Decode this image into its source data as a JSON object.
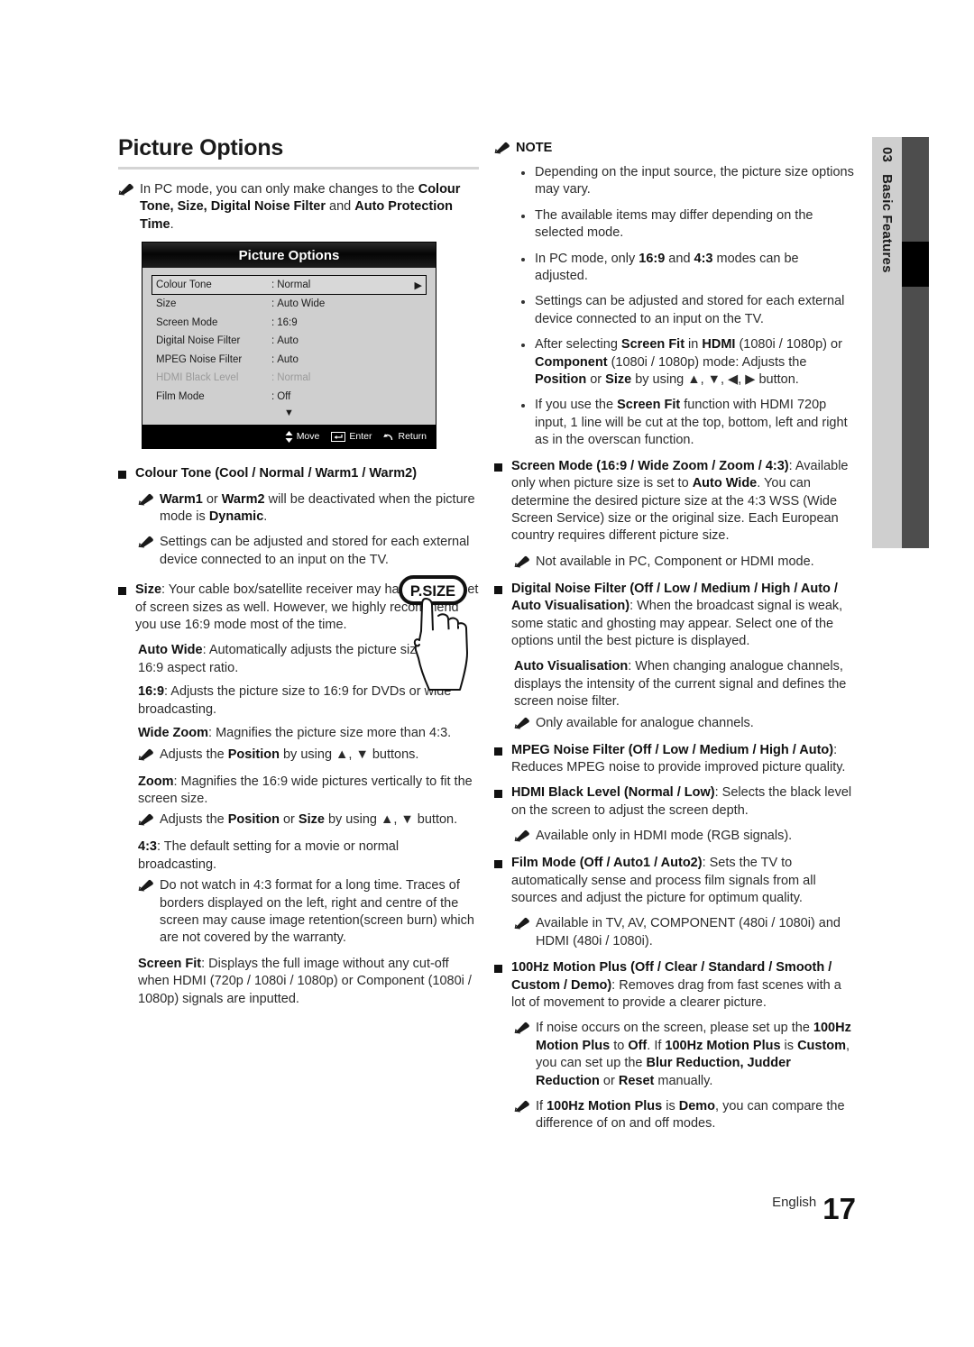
{
  "page_title": "Picture Options",
  "chapter_tab": {
    "number": "03",
    "label": "Basic Features"
  },
  "footer": {
    "language": "English",
    "page_number": "17"
  },
  "left_column": {
    "intro_note": {
      "line1": "In PC mode, you can only make changes to the ",
      "bold1": "Colour Tone, Size, Digital Noise Filter",
      "mid1": " and ",
      "bold2": "Auto Protection Time",
      "end1": "."
    },
    "osd": {
      "title": "Picture Options",
      "rows": [
        {
          "label": "Colour Tone",
          "value": "Normal",
          "selected": true,
          "dim": false,
          "arrow": "▶"
        },
        {
          "label": "Size",
          "value": "Auto Wide",
          "selected": false,
          "dim": false,
          "arrow": ""
        },
        {
          "label": "Screen Mode",
          "value": "16:9",
          "selected": false,
          "dim": false,
          "arrow": ""
        },
        {
          "label": "Digital Noise Filter",
          "value": "Auto",
          "selected": false,
          "dim": false,
          "arrow": ""
        },
        {
          "label": "MPEG Noise Filter",
          "value": "Auto",
          "selected": false,
          "dim": false,
          "arrow": ""
        },
        {
          "label": "HDMI Black Level",
          "value": "Normal",
          "selected": false,
          "dim": true,
          "arrow": ""
        },
        {
          "label": "Film Mode",
          "value": "Off",
          "selected": false,
          "dim": false,
          "arrow": ""
        }
      ],
      "scroll_down_icon": "▼",
      "footer": {
        "move": "Move",
        "enter": "Enter",
        "return": "Return"
      }
    },
    "remote_button_label": "P.SIZE",
    "items": {
      "colour_tone_heading": "Colour Tone (Cool / Normal / Warm1 / Warm2)",
      "colour_tone_note1_a": "Warm1",
      "colour_tone_note1_b": " or ",
      "colour_tone_note1_c": "Warm2",
      "colour_tone_note1_d": " will be deactivated when the picture mode is ",
      "colour_tone_note1_e": "Dynamic",
      "colour_tone_note1_f": ".",
      "colour_tone_note2": "Settings can be adjusted and stored for each external device connected to an input on the TV.",
      "size_heading_bold": "Size",
      "size_heading_rest": ": Your cable box/satellite receiver may have its own set of screen sizes as well. However, we highly recommend you use 16:9 mode most of the time.",
      "auto_wide_bold": "Auto Wide",
      "auto_wide_rest": ": Automatically adjusts the picture size to the 16:9 aspect ratio.",
      "sixteen_nine_bold": "16:9",
      "sixteen_nine_rest": ": Adjusts the picture size to 16:9 for DVDs or wide broadcasting.",
      "wide_zoom_bold": "Wide Zoom",
      "wide_zoom_rest": ": Magnifies the picture size more than 4:3.",
      "wide_zoom_note_a": "Adjusts the ",
      "wide_zoom_note_b": "Position",
      "wide_zoom_note_c": " by using ▲, ▼ buttons.",
      "zoom_bold": "Zoom",
      "zoom_rest": ": Magnifies the 16:9 wide pictures vertically to fit the screen size.",
      "zoom_note_a": "Adjusts the ",
      "zoom_note_b": "Position",
      "zoom_note_c": " or ",
      "zoom_note_d": "Size",
      "zoom_note_e": " by using ▲, ▼ button.",
      "four_three_bold": "4:3",
      "four_three_rest": ": The default setting for a movie or normal broadcasting.",
      "four_three_note": "Do not watch in 4:3 format for a long time. Traces of borders displayed on the left, right and centre of the screen may cause image retention(screen burn) which are not covered by the warranty.",
      "screen_fit_bold": "Screen Fit",
      "screen_fit_rest": ": Displays the full image without any cut-off when HDMI (720p / 1080i / 1080p) or Component (1080i / 1080p) signals are inputted."
    }
  },
  "right_column": {
    "note_heading": "NOTE",
    "notes": [
      {
        "text": "Depending on the input source, the picture size options may vary."
      },
      {
        "text": "The available items may differ depending on the selected mode."
      }
    ],
    "note3": {
      "a": "In PC mode, only ",
      "b": "16:9",
      "c": " and ",
      "d": "4:3",
      "e": " modes can be adjusted."
    },
    "note4": "Settings can be adjusted and stored for each external device connected to an input on the TV.",
    "note5": {
      "a": "After selecting ",
      "b": "Screen Fit",
      "c": " in ",
      "d": "HDMI",
      "e": " (1080i / 1080p) or ",
      "f": "Component",
      "g": " (1080i / 1080p) mode: Adjusts the ",
      "h": "Position",
      "i": " or ",
      "j": "Size",
      "k": " by using ▲, ▼, ◀, ▶ button."
    },
    "note6": {
      "a": "If you use the ",
      "b": "Screen Fit",
      "c": " function with HDMI 720p input, 1 line will be cut at the top, bottom, left and right as in the overscan function."
    },
    "screen_mode": {
      "heading": "Screen Mode (16:9 / Wide Zoom / Zoom / 4:3)",
      "body_a": ": Available only when picture size is set to ",
      "body_b": "Auto Wide",
      "body_c": ". You can determine the desired picture size at the 4:3 WSS (Wide Screen Service) size or the original size. Each European country requires different picture size.",
      "note": "Not available in PC, Component or HDMI mode."
    },
    "digital_noise_filter": {
      "heading": "Digital Noise Filter (Off / Low / Medium / High / Auto / Auto Visualisation)",
      "body": ": When the broadcast signal is weak, some static and ghosting may appear. Select one of the options until the best picture is displayed.",
      "auto_vis_bold": "Auto Visualisation",
      "auto_vis_rest": ": When changing analogue channels, displays the intensity of the current signal and defines the screen noise filter.",
      "note": "Only available for analogue channels."
    },
    "mpeg_noise_filter": {
      "heading": "MPEG Noise Filter (Off / Low / Medium / High / Auto)",
      "body": ": Reduces MPEG noise to provide improved picture quality."
    },
    "hdmi_black_level": {
      "heading": "HDMI Black Level (Normal / Low)",
      "body": ": Selects the black level on the screen to adjust the screen depth.",
      "note": "Available only in HDMI mode (RGB signals)."
    },
    "film_mode": {
      "heading": "Film Mode (Off / Auto1 / Auto2)",
      "body": ": Sets the TV to automatically sense and process film signals from all sources and adjust the picture for optimum quality.",
      "note": "Available in TV, AV, COMPONENT (480i / 1080i) and HDMI (480i / 1080i)."
    },
    "motion_plus": {
      "heading": "100Hz Motion Plus (Off / Clear / Standard / Smooth / Custom / Demo)",
      "body": ": Removes drag from fast scenes with a lot of movement to provide a clearer picture.",
      "note1": {
        "a": "If noise occurs on the screen, please set up the ",
        "b": "100Hz Motion Plus",
        "c": " to ",
        "d": "Off",
        "e": ". If ",
        "f": "100Hz Motion Plus",
        "g": " is ",
        "h": "Custom",
        "i": ", you can set up the ",
        "j": "Blur Reduction, Judder Reduction",
        "k": " or ",
        "l": "Reset",
        "m": " manually."
      },
      "note2": {
        "a": "If ",
        "b": "100Hz Motion Plus",
        "c": " is ",
        "d": "Demo",
        "e": ", you can compare the difference of on and off modes."
      }
    }
  },
  "icons": {
    "pencil": "pencil-note-icon",
    "square_bullet": "square-bullet-icon",
    "dot_bullet": "dot-bullet-icon",
    "up_down_arrows": "up-down-arrow-icon",
    "enter_key": "enter-key-icon",
    "return_arrow": "return-arrow-icon",
    "right_arrow": "right-arrow-icon",
    "down_arrow": "down-arrow-icon"
  },
  "colors": {
    "text": "#2b2b2b",
    "rule": "#d4d4d4",
    "osd_bg": "#cfcfcf",
    "tab_bg": "#cfcfcf",
    "tab_bar": "#4d4d4d",
    "tab_active": "#000000"
  }
}
